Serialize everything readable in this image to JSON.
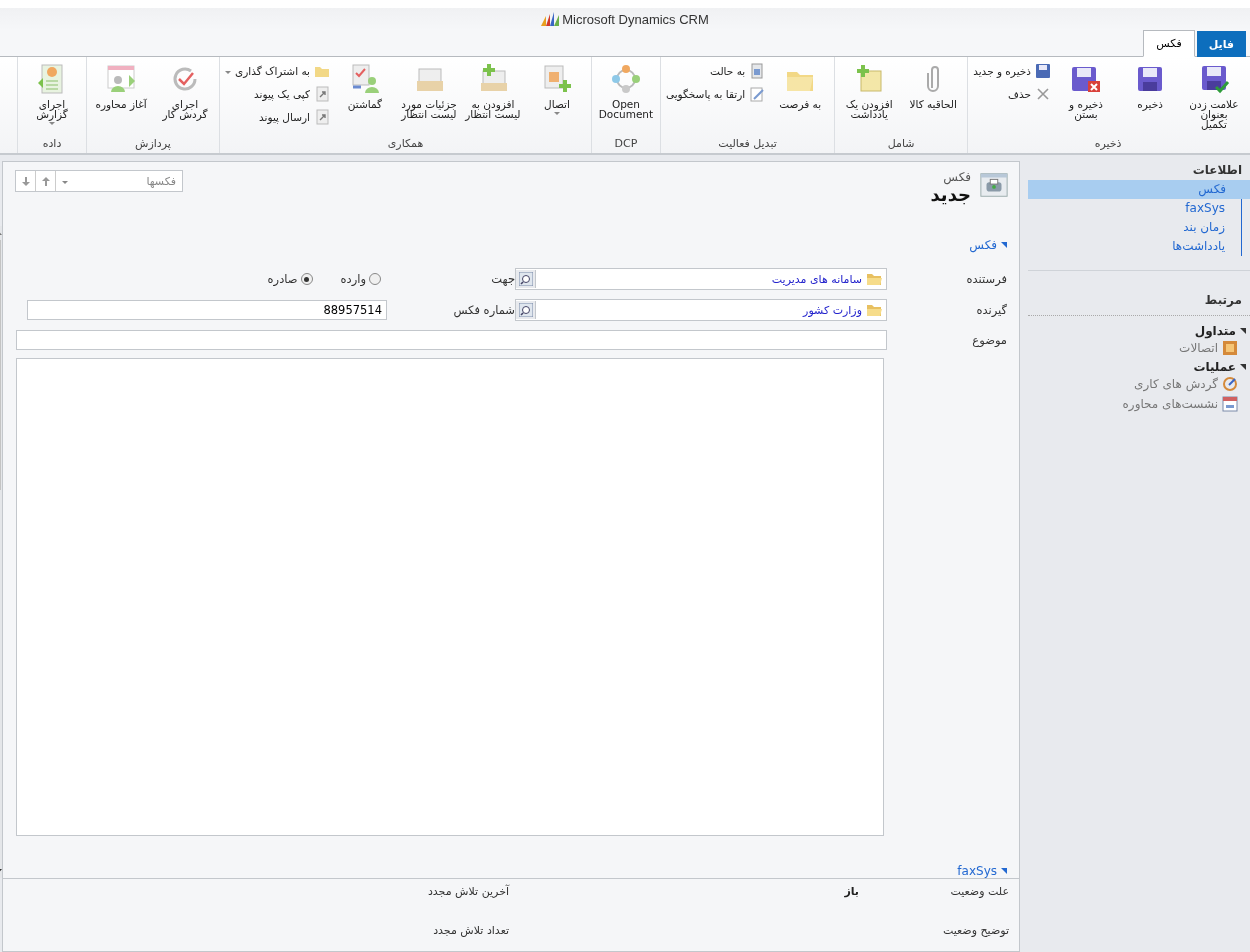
{
  "app": {
    "title": "Microsoft Dynamics CRM"
  },
  "ribbon_tabs": [
    {
      "label": "فایل",
      "kind": "file",
      "selected": false
    },
    {
      "label": "فکس",
      "kind": "tab",
      "selected": true
    }
  ],
  "ribbon_groups": [
    {
      "title": "ذخیره",
      "buttons": [
        {
          "label": "علامت زدن بعنوان تکمیل",
          "kind": "large"
        },
        {
          "label": "ذخیره",
          "kind": "large"
        },
        {
          "label": "ذخیره و بستن",
          "kind": "large"
        },
        {
          "label": "ذخیره و جدید",
          "kind": "small"
        },
        {
          "label": "حذف",
          "kind": "small"
        }
      ]
    },
    {
      "title": "شامل",
      "buttons": [
        {
          "label": "الحاقیه کالا",
          "kind": "large"
        },
        {
          "label": "افزودن یک یادداشت",
          "kind": "large"
        }
      ]
    },
    {
      "title": "تبدیل فعالیت",
      "buttons": [
        {
          "label": "به فرصت",
          "kind": "large"
        },
        {
          "label": "به حالت",
          "kind": "small"
        },
        {
          "label": "ارتقا به پاسخگویی",
          "kind": "small"
        }
      ]
    },
    {
      "title": "DCP",
      "buttons": [
        {
          "label": "Open Document",
          "kind": "large"
        }
      ]
    },
    {
      "title": "همکاری",
      "buttons": [
        {
          "label": "اتصال",
          "kind": "large",
          "dropdown": true
        },
        {
          "label": "افزودن به لیست انتظار",
          "kind": "large"
        },
        {
          "label": "جزئیات مورد لیست انتظار",
          "kind": "large"
        },
        {
          "label": "گماشتن",
          "kind": "large"
        },
        {
          "label": "به اشتراک گذاری",
          "kind": "small",
          "dropdown": true
        },
        {
          "label": "کپی یک پیوند",
          "kind": "small"
        },
        {
          "label": "ارسال پیوند",
          "kind": "small"
        }
      ]
    },
    {
      "title": "پردازش",
      "buttons": [
        {
          "label": "اجرای گردش کار",
          "kind": "large"
        },
        {
          "label": "آغاز محاوره",
          "kind": "large"
        }
      ]
    },
    {
      "title": "داده",
      "buttons": [
        {
          "label": "اجرای گزارش",
          "kind": "large",
          "dropdown": true
        }
      ]
    }
  ],
  "nav": {
    "info_title": "اطلاعات",
    "info_items": [
      {
        "label": "فکس",
        "selected": true
      },
      {
        "label": "faxSys",
        "selected": false
      },
      {
        "label": "زمان بند",
        "selected": false
      },
      {
        "label": "یادداشت‌ها",
        "selected": false
      }
    ],
    "related_title": "مرتبط",
    "groups": [
      {
        "title": "متداول",
        "expanded": true,
        "items": [
          {
            "label": "اتصالات"
          }
        ]
      },
      {
        "title": "عملیات",
        "expanded": true,
        "items": [
          {
            "label": "گردش های کاری"
          },
          {
            "label": "نشست‌های محاوره"
          }
        ]
      }
    ]
  },
  "form": {
    "entity": "فکس",
    "title": "جدید",
    "record_nav": {
      "value": "فکسها"
    },
    "fax_section": {
      "title": "فکس",
      "expanded": true
    },
    "sender": {
      "label": "فرستنده",
      "value": "سامانه های مدیریت"
    },
    "direction": {
      "label": "جهت",
      "options": [
        {
          "label": "وارده",
          "selected": false
        },
        {
          "label": "صادره",
          "selected": true
        }
      ]
    },
    "recipient": {
      "label": "گیرنده",
      "value": "وزارت کشور"
    },
    "fax_number": {
      "label": "شماره فکس",
      "value": "88957514"
    },
    "subject": {
      "label": "موضوع"
    },
    "faxsys_section": {
      "title": "faxSys",
      "expanded": true
    }
  },
  "footer": [
    {
      "label": "علت وضعیت",
      "value": "باز"
    },
    {
      "label": "آخرین تلاش مجدد"
    },
    {
      "label": "توضیح وضعیت"
    },
    {
      "label": "تعداد تلاش مجدد"
    }
  ]
}
